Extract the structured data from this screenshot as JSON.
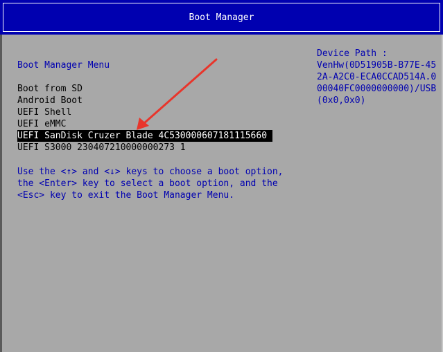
{
  "header": {
    "title": "Boot Manager"
  },
  "menu": {
    "heading": "Boot Manager Menu",
    "entries": [
      "Boot from SD",
      "Android Boot",
      "UEFI Shell",
      "UEFI eMMC",
      "UEFI SanDisk Cruzer Blade 4C530000607181115660",
      "UEFI S3000 230407210000000273 1"
    ],
    "selected_index": 4
  },
  "help": {
    "lines": [
      "Use the <↑> and <↓> keys to choose a boot option,",
      "the <Enter> key to select a boot option, and the",
      "<Esc> key to exit the Boot Manager Menu."
    ]
  },
  "device_path": {
    "lines": [
      "Device Path :",
      "VenHw(0D51905B-B77E-45",
      "2A-A2C0-ECA0CCAD514A.0",
      "00040FC0000000000)/USB",
      "(0x0,0x0)"
    ]
  },
  "annotation": {
    "arrow_color": "#e8352b",
    "icon": "red-arrow-icon"
  }
}
